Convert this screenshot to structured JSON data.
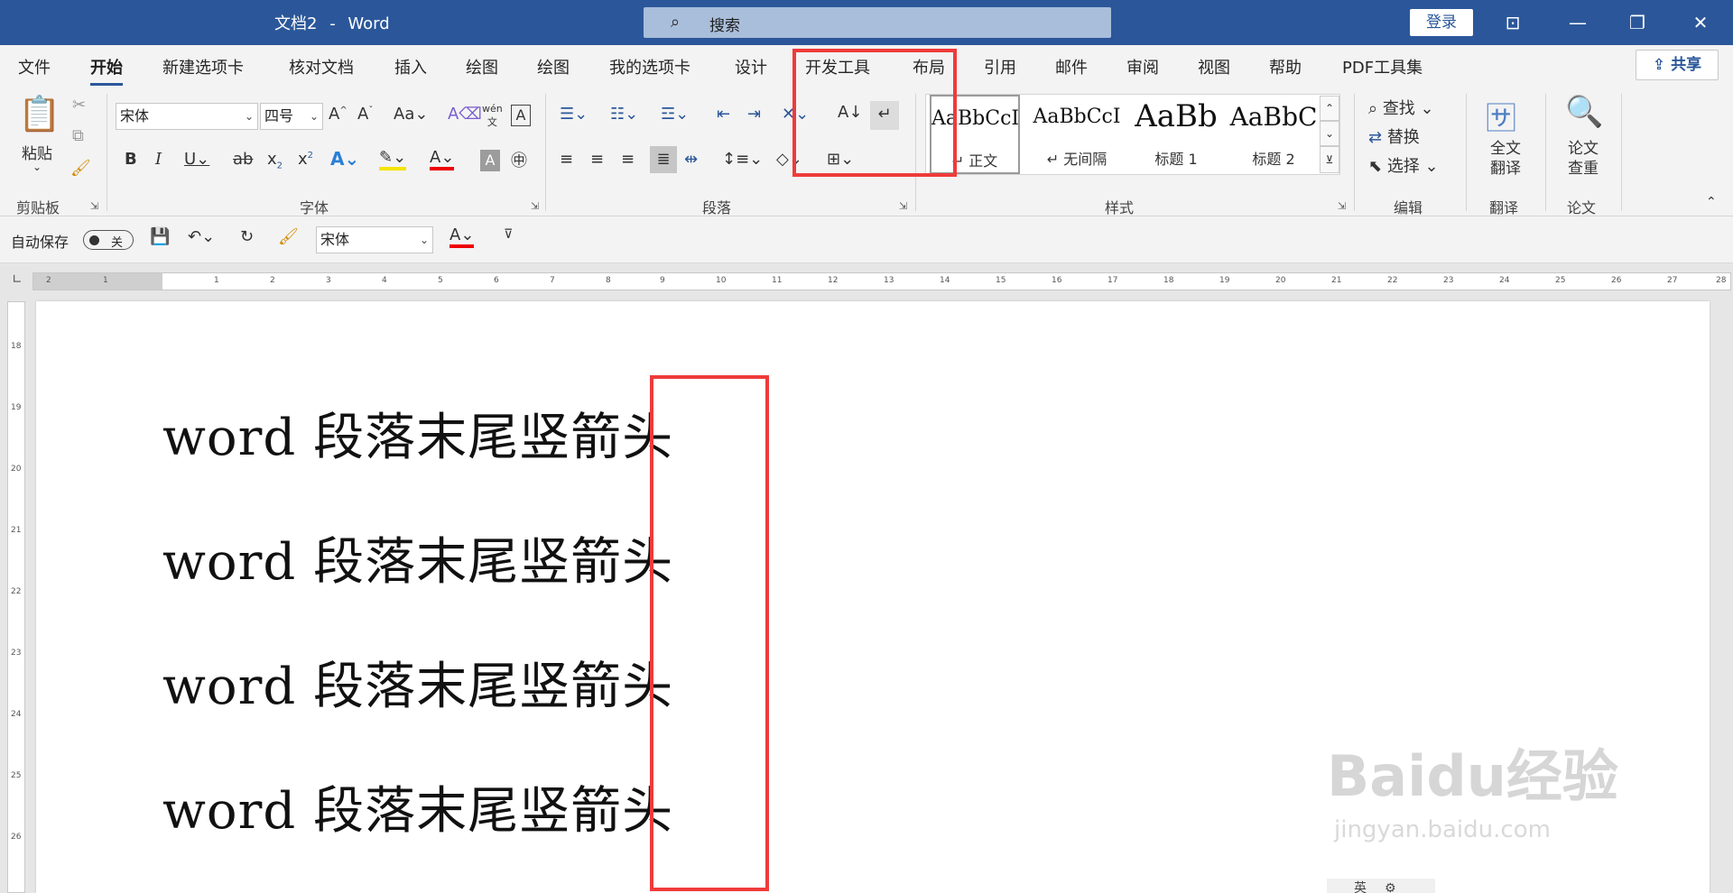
{
  "title": {
    "doc": "文档2",
    "dash": "-",
    "app": "Word",
    "search": "搜索",
    "login": "登录"
  },
  "menu": {
    "tabs": [
      "文件",
      "开始",
      "新建选项卡",
      "核对文档",
      "插入",
      "绘图",
      "绘图",
      "我的选项卡",
      "设计",
      "开发工具",
      "布局",
      "引用",
      "邮件",
      "审阅",
      "视图",
      "帮助",
      "PDF工具集"
    ],
    "share": "共享"
  },
  "ribbon": {
    "clipboard": {
      "label": "剪贴板",
      "paste": "粘贴"
    },
    "font": {
      "label": "字体",
      "font_name": "宋体",
      "font_size": "四号"
    },
    "paragraph": {
      "label": "段落"
    },
    "styles": {
      "label": "样式",
      "items": [
        {
          "sample": "AaBbCcI",
          "name": "正文"
        },
        {
          "sample": "AaBbCcI",
          "name": "无间隔"
        },
        {
          "sample": "AaBb",
          "name": "标题 1"
        },
        {
          "sample": "AaBbC",
          "name": "标题 2"
        }
      ]
    },
    "editing": {
      "label": "编辑",
      "find": "查找",
      "replace": "替换",
      "select": "选择"
    },
    "translate": {
      "label": "翻译",
      "btn_line1": "全文",
      "btn_line2": "翻译"
    },
    "paper": {
      "label": "论文",
      "btn_line1": "论文",
      "btn_line2": "查重"
    }
  },
  "qat": {
    "autosave": "自动保存",
    "toggle": "关",
    "font": "宋体"
  },
  "ruler": {
    "h": [
      "2",
      "1",
      "1",
      "2",
      "3",
      "4",
      "5",
      "6",
      "7",
      "8",
      "9",
      "10",
      "11",
      "12",
      "13",
      "14",
      "15",
      "16",
      "17",
      "18",
      "19",
      "20",
      "21",
      "22",
      "23",
      "24",
      "25",
      "26",
      "27",
      "28"
    ],
    "v": [
      "18",
      "19",
      "20",
      "21",
      "22",
      "23",
      "24",
      "25",
      "26"
    ]
  },
  "document": {
    "paragraphs": [
      "word 段落末尾竖箭头",
      "word 段落末尾竖箭头",
      "word 段落末尾竖箭头",
      "word 段落末尾竖箭头"
    ]
  },
  "watermark": {
    "logo": "Baidu经验",
    "url": "jingyan.baidu.com"
  },
  "float_bar": {
    "label": "英"
  },
  "colors": {
    "word_blue": "#2b579a",
    "highlight_red": "#ef3b3b"
  }
}
